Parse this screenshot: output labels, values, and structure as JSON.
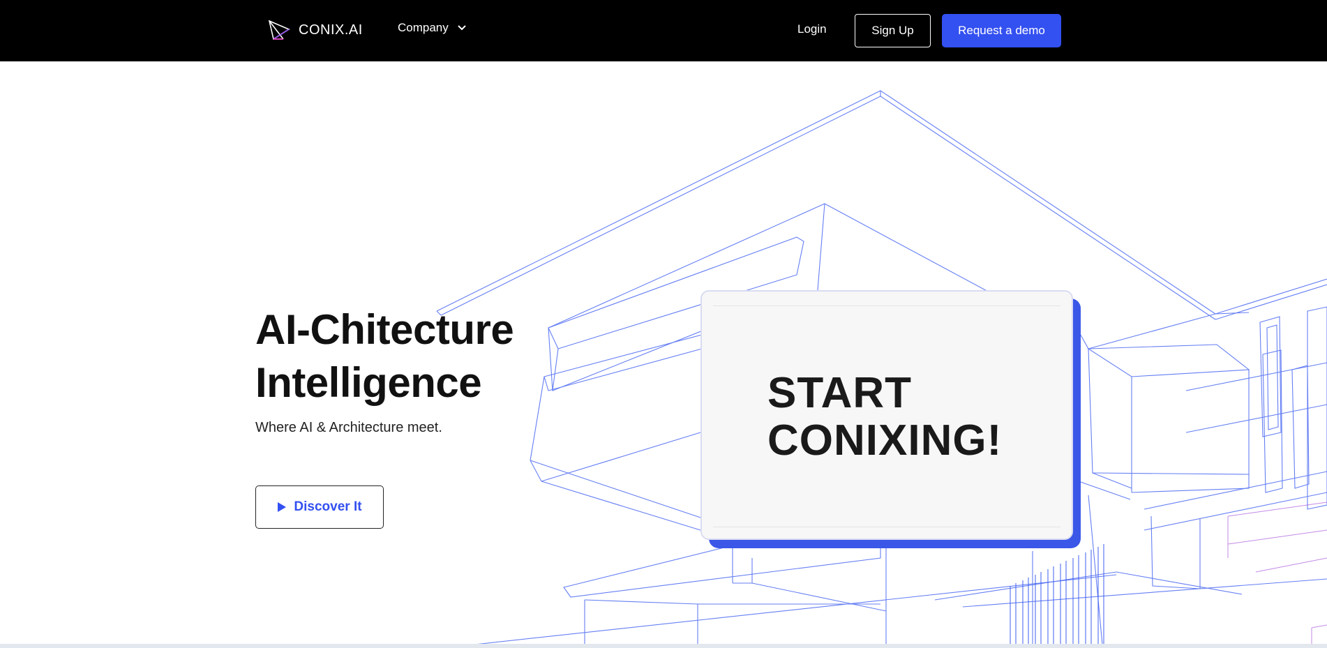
{
  "nav": {
    "logo_text": "CONIX.AI",
    "company_label": "Company",
    "login_label": "Login",
    "signup_label": "Sign Up",
    "demo_label": "Request a demo"
  },
  "hero": {
    "title_line1": "AI-Chitecture",
    "title_line2": "Intelligence",
    "subtitle": "Where AI & Architecture meet.",
    "discover_label": "Discover It"
  },
  "card": {
    "line1": "START",
    "line2": "CONIXING!"
  },
  "colors": {
    "navbar": "#000000",
    "accent": "#3350f0",
    "card_shadow": "#3a57e8",
    "wireframe": "#3d5cf0",
    "wireframe_alt": "#9b3dd6"
  },
  "icons": {
    "logo": "conix-logo-icon",
    "dropdown": "chevron-down-icon",
    "play": "play-icon"
  }
}
